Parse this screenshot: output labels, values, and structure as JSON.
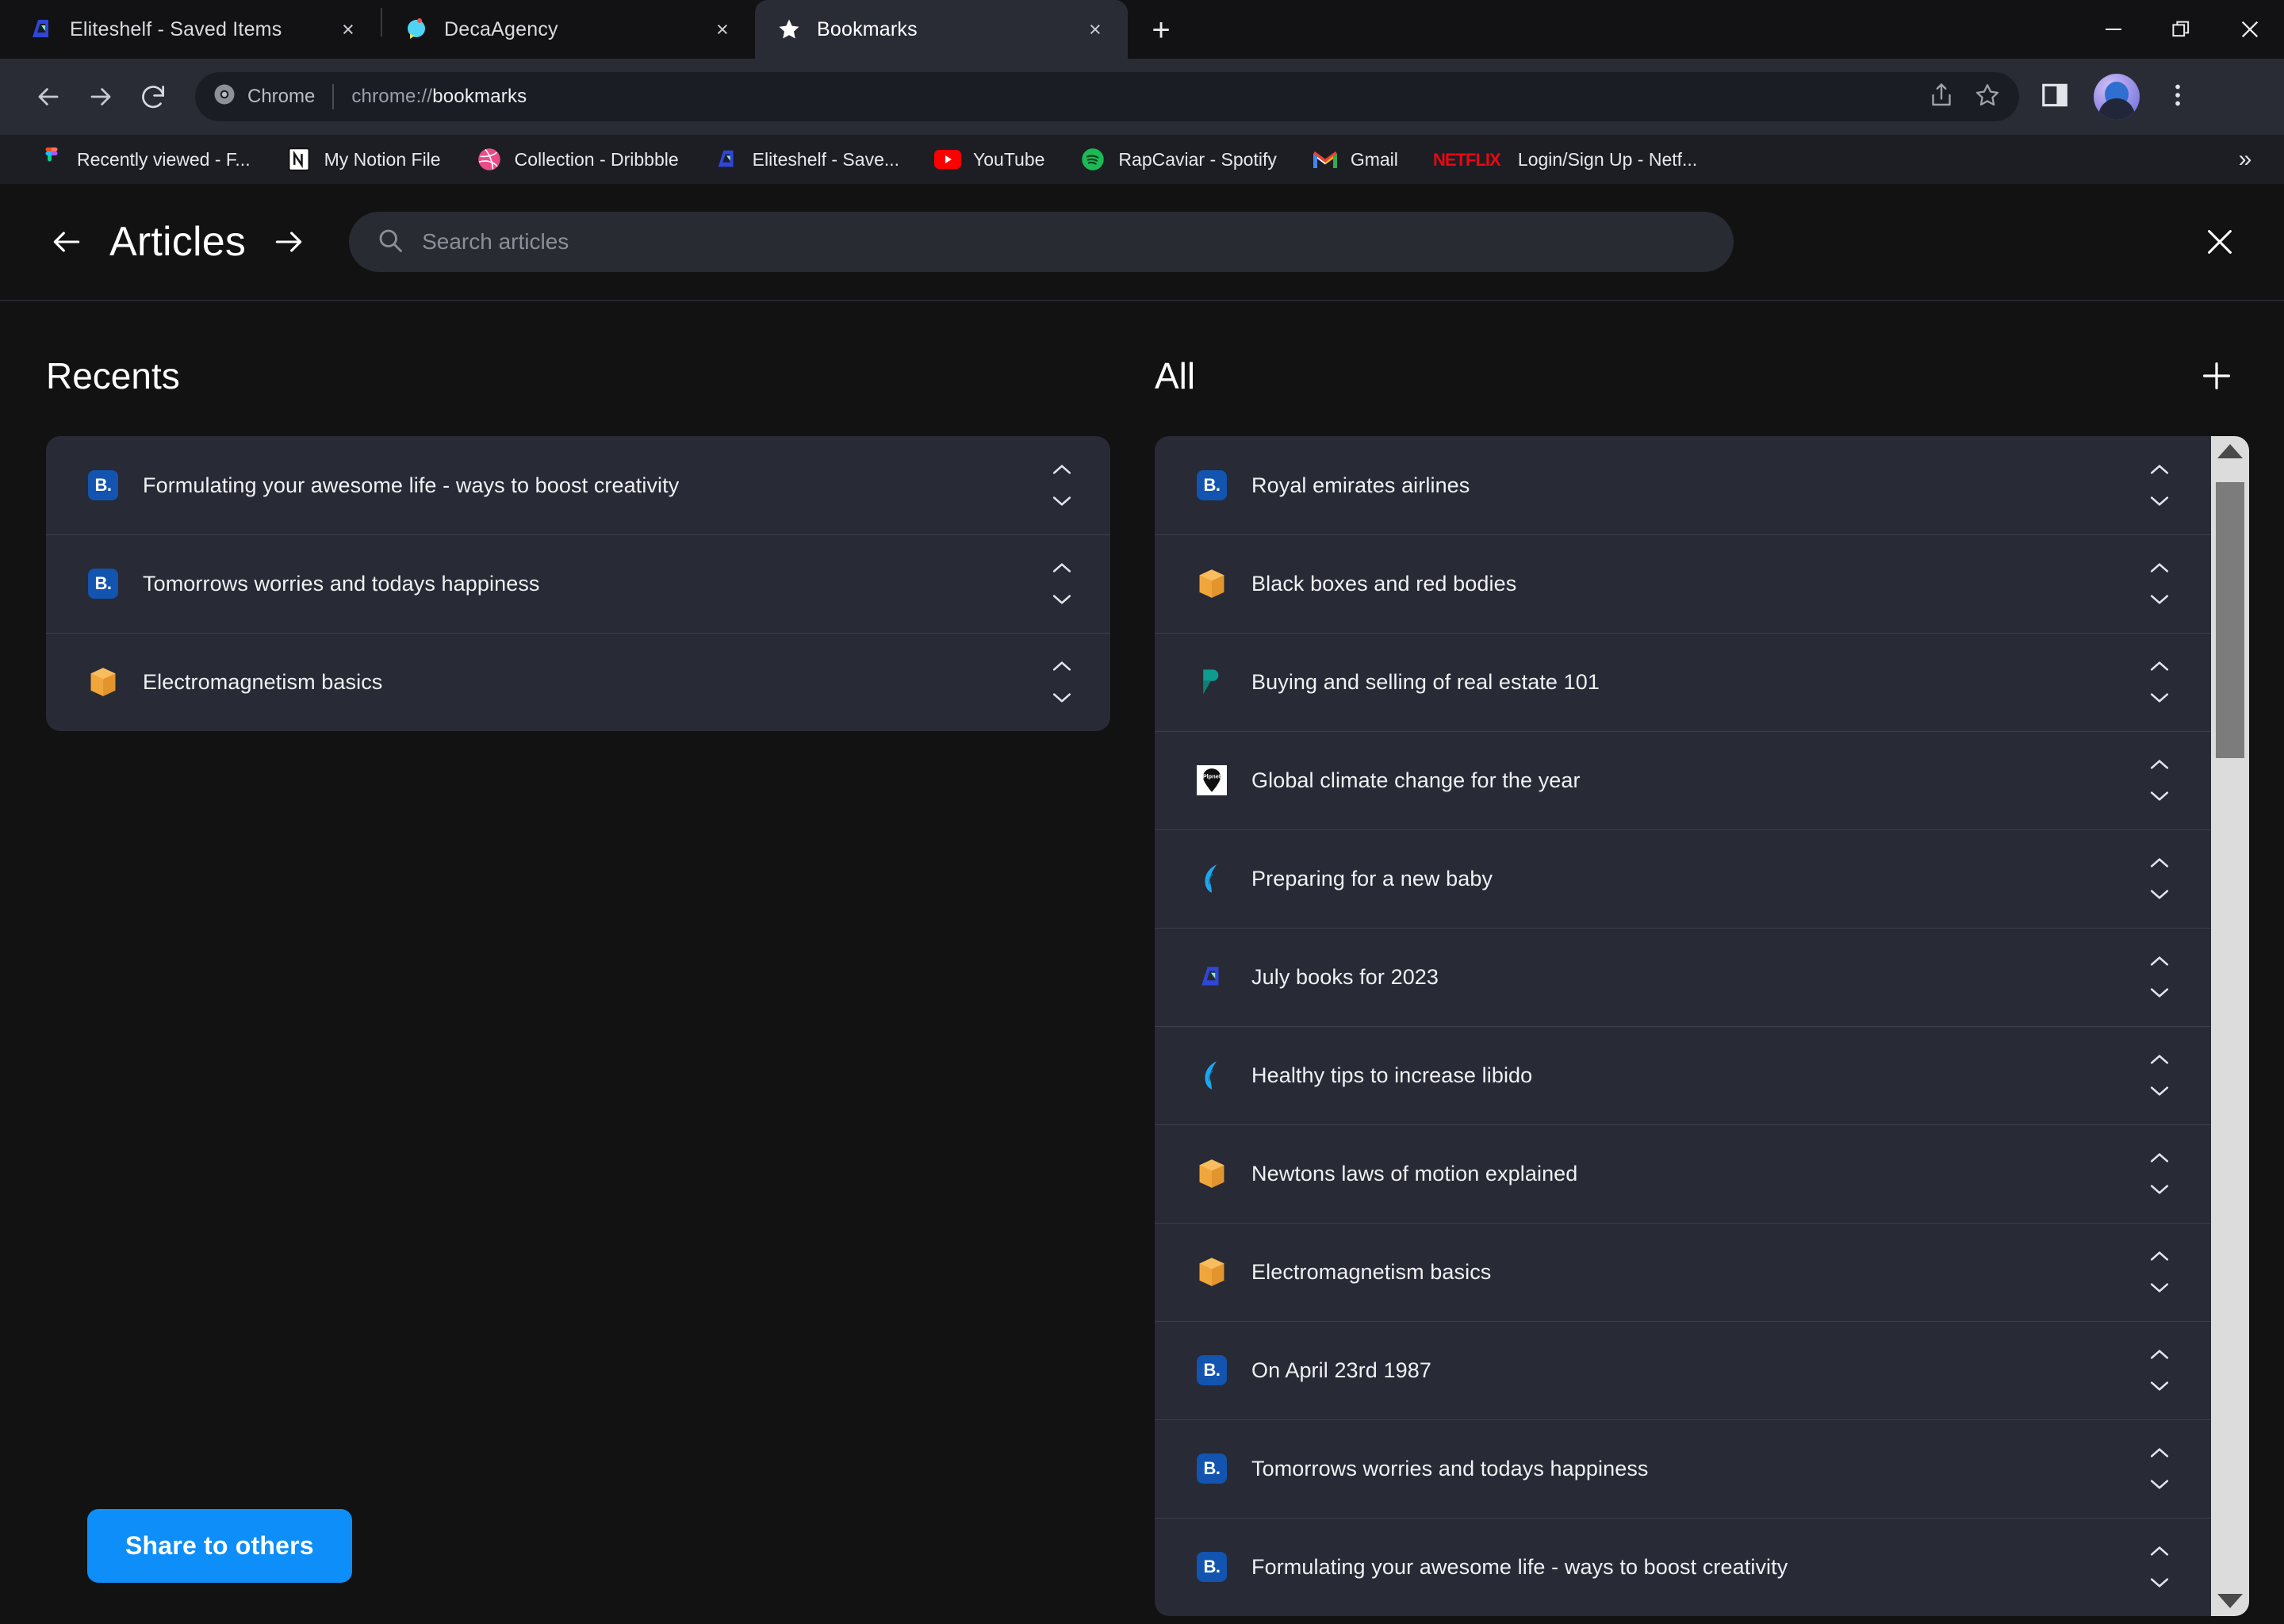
{
  "browser": {
    "tabs": [
      {
        "title": "Eliteshelf - Saved Items",
        "favicon": "eliteshelf-icon",
        "active": false,
        "close": "×"
      },
      {
        "title": "DecaAgency",
        "favicon": "decaagency-icon",
        "active": false,
        "close": "×"
      },
      {
        "title": "Bookmarks",
        "favicon": "star-icon",
        "active": true,
        "close": "×"
      }
    ],
    "new_tab_label": "+",
    "window_controls": {
      "minimize": "—",
      "maximize": "restore-icon",
      "close": "×"
    },
    "toolbar": {
      "back": "back-arrow-icon",
      "forward": "forward-arrow-icon",
      "reload": "reload-icon",
      "omnibox_chip": "Chrome",
      "url_scheme": "chrome://",
      "url_path": "bookmarks",
      "share": "share-icon",
      "bookmark_star": "star-outline-icon",
      "side_panel": "side-panel-icon",
      "profile": "avatar",
      "menu": "three-dot-menu-icon"
    },
    "bookmarks_bar": [
      {
        "label": "Recently viewed - F...",
        "icon": "figma-icon"
      },
      {
        "label": "My Notion File",
        "icon": "notion-icon"
      },
      {
        "label": "Collection - Dribbble",
        "icon": "dribbble-icon"
      },
      {
        "label": "Eliteshelf - Save...",
        "icon": "eliteshelf-icon"
      },
      {
        "label": "YouTube",
        "icon": "youtube-icon"
      },
      {
        "label": "RapCaviar - Spotify",
        "icon": "spotify-icon"
      },
      {
        "label": "Gmail",
        "icon": "gmail-icon"
      },
      {
        "label": "Login/Sign Up - Netf...",
        "icon": "netflix-icon"
      }
    ],
    "bookmarks_overflow": "»"
  },
  "app": {
    "header": {
      "back_icon": "arrow-left-icon",
      "title": "Articles",
      "forward_icon": "arrow-right-icon",
      "search_icon": "search-icon",
      "search_value": "",
      "search_placeholder": "Search articles",
      "close_icon": "close-icon"
    },
    "recents": {
      "heading": "Recents",
      "items": [
        {
          "label": "Formulating your awesome life - ways to boost creativity",
          "icon": "bookmark-b-icon"
        },
        {
          "label": "Tomorrows worries and todays happiness",
          "icon": "bookmark-b-icon"
        },
        {
          "label": "Electromagnetism basics",
          "icon": "package-icon"
        }
      ]
    },
    "all": {
      "heading": "All",
      "add_label": "+",
      "items": [
        {
          "label": "Royal emirates airlines",
          "icon": "bookmark-b-icon"
        },
        {
          "label": "Black boxes and red bodies",
          "icon": "package-icon"
        },
        {
          "label": "Buying and selling of real estate 101",
          "icon": "realestate-icon"
        },
        {
          "label": "Global climate change for the year",
          "icon": "planet-icon"
        },
        {
          "label": "Preparing for a new baby",
          "icon": "feather-icon"
        },
        {
          "label": "July books for 2023",
          "icon": "eliteshelf-icon"
        },
        {
          "label": "Healthy tips to increase libido",
          "icon": "feather-icon"
        },
        {
          "label": "Newtons laws of motion explained",
          "icon": "package-icon"
        },
        {
          "label": "Electromagnetism basics",
          "icon": "package-icon"
        },
        {
          "label": "On April 23rd 1987",
          "icon": "bookmark-b-icon"
        },
        {
          "label": "Tomorrows worries and todays happiness",
          "icon": "bookmark-b-icon"
        },
        {
          "label": "Formulating your awesome life - ways to boost creativity",
          "icon": "bookmark-b-icon"
        }
      ],
      "scrollbar": {
        "up_arrow": "scroll-up-icon",
        "down_arrow": "scroll-down-icon"
      }
    },
    "share_button": "Share to others",
    "sort_up_icon": "chevron-up-icon",
    "sort_down_icon": "chevron-down-icon"
  },
  "colors": {
    "page_bg": "#121212",
    "card_bg": "#282a35",
    "accent_blue": "#0d8ef8",
    "bookmark_icon_blue": "#1254b0",
    "package_orange": "#f0a63a",
    "feather_blue": "#1ea7f0",
    "realestate_teal": "#0f9b8e",
    "browser_toolbar": "#2a2c35"
  }
}
